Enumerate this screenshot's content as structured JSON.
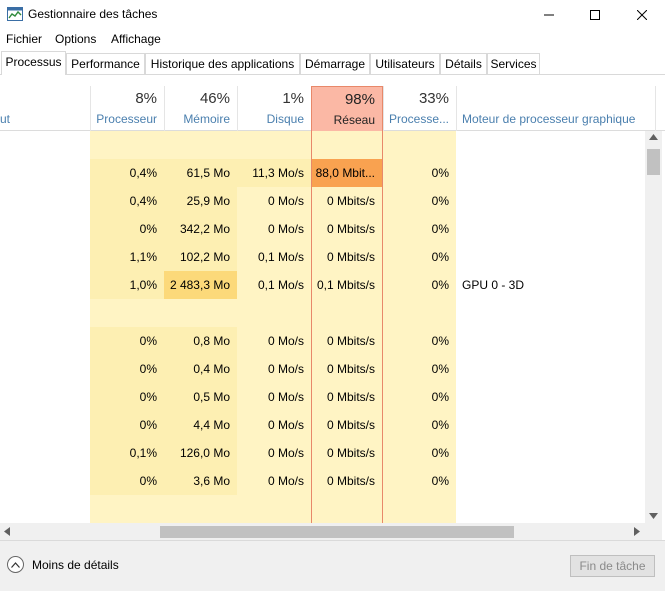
{
  "window": {
    "title": "Gestionnaire des tâches"
  },
  "menu": [
    "Fichier",
    "Options",
    "Affichage"
  ],
  "tabs": [
    "Processus",
    "Performance",
    "Historique des applications",
    "Démarrage",
    "Utilisateurs",
    "Détails",
    "Services"
  ],
  "header": {
    "left_label": "ut",
    "columns": [
      {
        "pct": "8%",
        "label": "Processeur"
      },
      {
        "pct": "46%",
        "label": "Mémoire"
      },
      {
        "pct": "1%",
        "label": "Disque"
      },
      {
        "pct": "98%",
        "label": "Réseau"
      },
      {
        "pct": "33%",
        "label": "Processe..."
      }
    ],
    "gpu_engine_label": "Moteur de processeur graphique"
  },
  "rows": [
    {
      "cpu": "",
      "mem": "",
      "disk": "",
      "net": "",
      "gpu": "",
      "engine": ""
    },
    {
      "cpu": "0,4%",
      "mem": "61,5 Mo",
      "disk": "11,3 Mo/s",
      "net": "88,0 Mbit...",
      "gpu": "0%",
      "engine": ""
    },
    {
      "cpu": "0,4%",
      "mem": "25,9 Mo",
      "disk": "0 Mo/s",
      "net": "0 Mbits/s",
      "gpu": "0%",
      "engine": ""
    },
    {
      "cpu": "0%",
      "mem": "342,2 Mo",
      "disk": "0 Mo/s",
      "net": "0 Mbits/s",
      "gpu": "0%",
      "engine": ""
    },
    {
      "cpu": "1,1%",
      "mem": "102,2 Mo",
      "disk": "0,1 Mo/s",
      "net": "0 Mbits/s",
      "gpu": "0%",
      "engine": ""
    },
    {
      "cpu": "1,0%",
      "mem": "2 483,3 Mo",
      "disk": "0,1 Mo/s",
      "net": "0,1 Mbits/s",
      "gpu": "0%",
      "engine": "GPU 0 - 3D"
    },
    {
      "cpu": "",
      "mem": "",
      "disk": "",
      "net": "",
      "gpu": "",
      "engine": ""
    },
    {
      "cpu": "0%",
      "mem": "0,8 Mo",
      "disk": "0 Mo/s",
      "net": "0 Mbits/s",
      "gpu": "0%",
      "engine": ""
    },
    {
      "cpu": "0%",
      "mem": "0,4 Mo",
      "disk": "0 Mo/s",
      "net": "0 Mbits/s",
      "gpu": "0%",
      "engine": ""
    },
    {
      "cpu": "0%",
      "mem": "0,5 Mo",
      "disk": "0 Mo/s",
      "net": "0 Mbits/s",
      "gpu": "0%",
      "engine": ""
    },
    {
      "cpu": "0%",
      "mem": "4,4 Mo",
      "disk": "0 Mo/s",
      "net": "0 Mbits/s",
      "gpu": "0%",
      "engine": ""
    },
    {
      "cpu": "0,1%",
      "mem": "126,0 Mo",
      "disk": "0 Mo/s",
      "net": "0 Mbits/s",
      "gpu": "0%",
      "engine": ""
    },
    {
      "cpu": "0%",
      "mem": "3,6 Mo",
      "disk": "0 Mo/s",
      "net": "0 Mbits/s",
      "gpu": "0%",
      "engine": ""
    }
  ],
  "footer": {
    "less_details": "Moins de détails",
    "end_task": "Fin de tâche"
  },
  "colors": {
    "heat_light": "#fff4c4",
    "heat_row": "#fdefb2",
    "heat_mem_high": "#fcd97a",
    "net_high": "#f9a250",
    "net_col_border": "#e8886a"
  }
}
